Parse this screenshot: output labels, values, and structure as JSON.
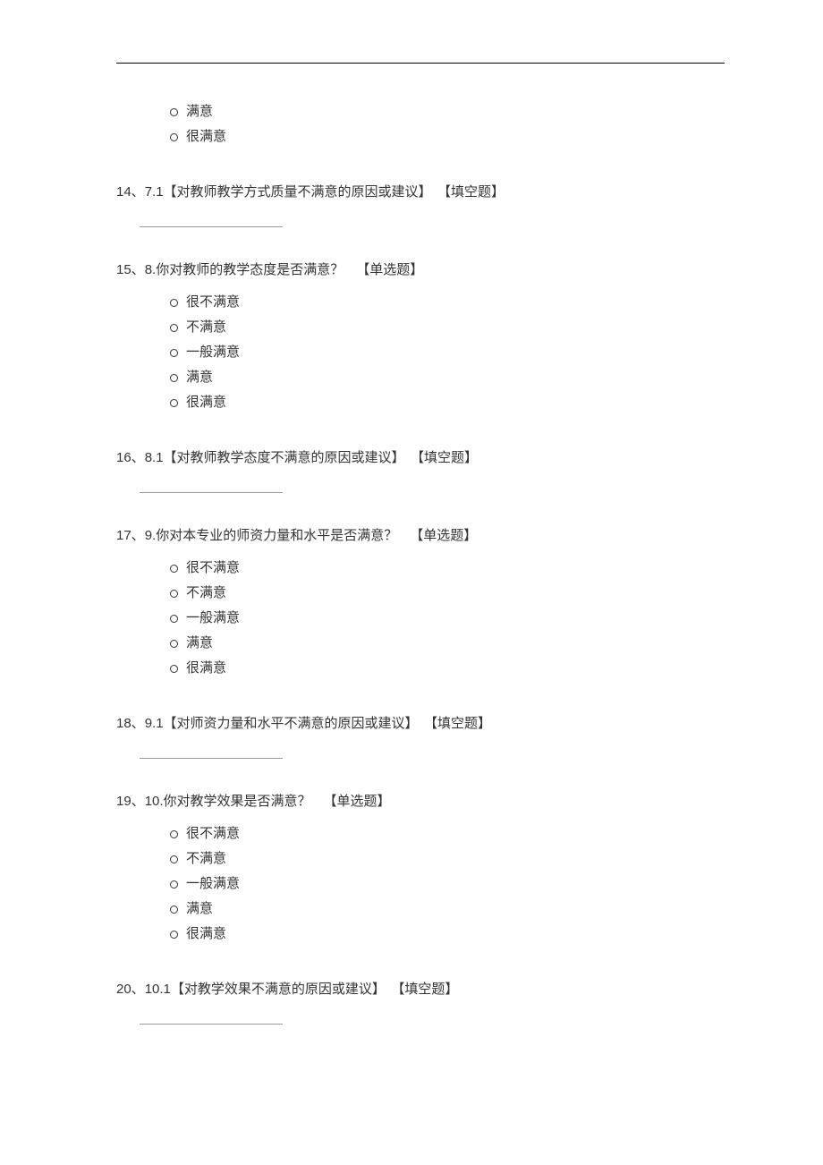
{
  "partial_q13": {
    "options": [
      "满意",
      "很满意"
    ]
  },
  "questions": [
    {
      "number": "14、",
      "label": "7.1【对教师教学方式质量不满意的原因或建议】",
      "tag": "【填空题】",
      "type": "fill"
    },
    {
      "number": "15、",
      "label": "8.你对教师的教学态度是否满意？",
      "tag": "【单选题】",
      "type": "single",
      "options": [
        "很不满意",
        "不满意",
        "一般满意",
        "满意",
        "很满意"
      ]
    },
    {
      "number": "16、",
      "label": "8.1【对教师教学态度不满意的原因或建议】",
      "tag": "【填空题】",
      "type": "fill"
    },
    {
      "number": "17、",
      "label": "9.你对本专业的师资力量和水平是否满意？",
      "tag": "【单选题】",
      "type": "single",
      "options": [
        "很不满意",
        "不满意",
        "一般满意",
        "满意",
        "很满意"
      ]
    },
    {
      "number": "18、",
      "label": "9.1【对师资力量和水平不满意的原因或建议】",
      "tag": "【填空题】",
      "type": "fill"
    },
    {
      "number": "19、",
      "label": "10.你对教学效果是否满意？",
      "tag": "【单选题】",
      "type": "single",
      "options": [
        "很不满意",
        "不满意",
        "一般满意",
        "满意",
        "很满意"
      ]
    },
    {
      "number": "20、",
      "label": "10.1【对教学效果不满意的原因或建议】",
      "tag": "【填空题】",
      "type": "fill"
    }
  ]
}
